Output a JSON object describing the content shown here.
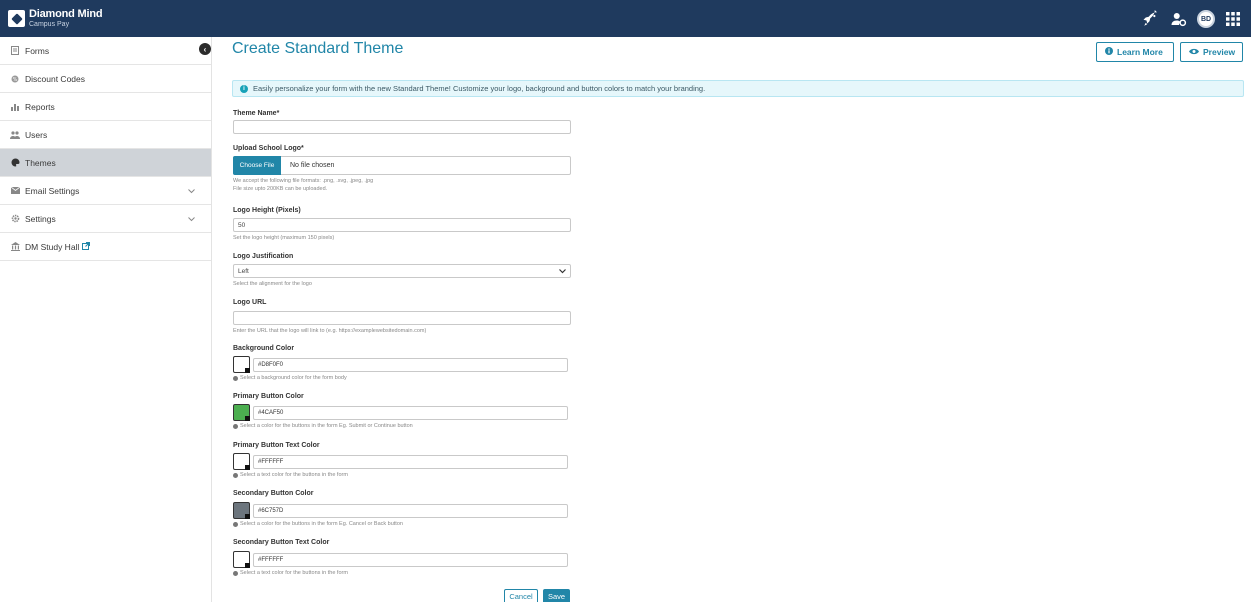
{
  "brand": {
    "name": "Diamond Mind",
    "sub": "Campus Pay"
  },
  "topbar": {
    "avatar_initials": "BD",
    "icons": [
      "rocket-icon",
      "user-gear-icon",
      "avatar",
      "apps-grid-icon"
    ]
  },
  "sidebar": {
    "items": [
      {
        "label": "Forms",
        "icon": "form-icon"
      },
      {
        "label": "Discount Codes",
        "icon": "discount-icon"
      },
      {
        "label": "Reports",
        "icon": "bar-chart-icon"
      },
      {
        "label": "Users",
        "icon": "users-icon"
      },
      {
        "label": "Themes",
        "icon": "palette-icon",
        "active": true
      },
      {
        "label": "Email Settings",
        "icon": "mail-icon",
        "has_chevron": true
      },
      {
        "label": "Settings",
        "icon": "gear-icon",
        "has_chevron": true
      },
      {
        "label": "DM Study Hall",
        "icon": "bank-icon",
        "external": true
      }
    ]
  },
  "main": {
    "title": "Create Standard Theme",
    "learn_more": "Learn More",
    "preview": "Preview",
    "alert": "Easily personalize your form with the new Standard Theme! Customize your logo, background and button colors to match your branding."
  },
  "form": {
    "theme_name": {
      "label": "Theme Name*",
      "value": ""
    },
    "logo": {
      "label": "Upload School Logo*",
      "button": "Choose File",
      "status": "No file chosen",
      "help1": "We accept the following file formats: .png, .svg, .jpeg, .jpg",
      "help2": "File size upto 200KB can be uploaded."
    },
    "logo_height": {
      "label": "Logo Height (Pixels)",
      "value": "50",
      "help": "Set the logo height (maximum 150 pixels)"
    },
    "logo_justification": {
      "label": "Logo Justification",
      "value": "Left",
      "help": "Select the alignment for the logo"
    },
    "logo_url": {
      "label": "Logo URL",
      "value": "",
      "help": "Enter the URL that the logo will link to (e.g. https://examplewebsitedomain.com)"
    },
    "background_color": {
      "label": "Background Color",
      "value": "#D8F0F0",
      "help": "Select a background color for the form body",
      "swatch": "#ffffff"
    },
    "primary_button_color": {
      "label": "Primary Button Color",
      "value": "#4CAF50",
      "help": "Select a color for the buttons in the form Eg. Submit or Continue button",
      "swatch": "#4CAF50"
    },
    "primary_button_text_color": {
      "label": "Primary Button Text Color",
      "value": "#FFFFFF",
      "help": "Select a text color for the buttons in the form",
      "swatch": "#FFFFFF"
    },
    "secondary_button_color": {
      "label": "Secondary Button Color",
      "value": "#6C757D",
      "help": "Select a color for the buttons in the form Eg. Cancel or Back button",
      "swatch": "#6C757D"
    },
    "secondary_button_text_color": {
      "label": "Secondary Button Text Color",
      "value": "#FFFFFF",
      "help": "Select a text color for the buttons in the form",
      "swatch": "#FFFFFF"
    },
    "cancel": "Cancel",
    "save": "Save"
  },
  "colors": {
    "topbar": "#1f3a5e",
    "accent": "#2186a8",
    "active_nav": "#cfd3d8"
  }
}
